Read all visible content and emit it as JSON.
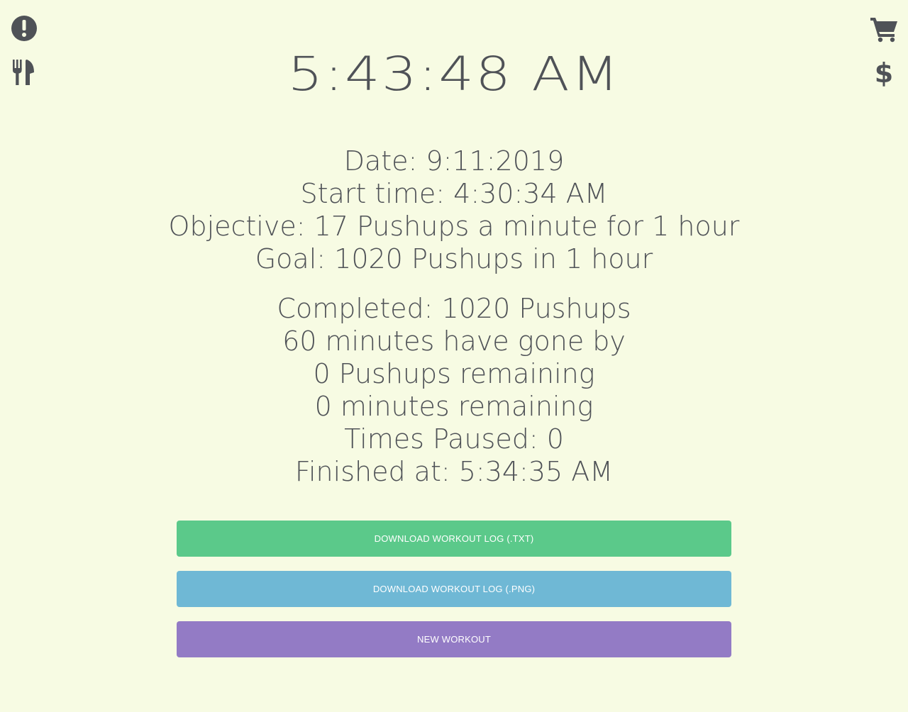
{
  "icons": {
    "top_left": [
      "alert-icon",
      "cutlery-icon"
    ],
    "top_right": [
      "cart-icon",
      "dollar-icon"
    ],
    "color": "#4f5257"
  },
  "clock": {
    "time": "5:43:48 AM"
  },
  "summary": {
    "date": "Date: 9:11:2019",
    "start_time": "Start time: 4:30:34 AM",
    "objective": "Objective: 17 Pushups a minute for 1 hour",
    "goal": "Goal: 1020 Pushups in 1 hour",
    "completed": "Completed: 1020 Pushups",
    "elapsed": "60 minutes have gone by",
    "pushups_remaining": "0 Pushups remaining",
    "minutes_remaining": "0 minutes remaining",
    "times_paused": "Times Paused: 0",
    "finished_at": "Finished at: 5:34:35 AM"
  },
  "actions": {
    "download_txt": "DOWNLOAD WORKOUT LOG (.TXT)",
    "download_png": "DOWNLOAD WORKOUT LOG (.PNG)",
    "new_workout": "NEW WORKOUT"
  },
  "colors": {
    "background": "#f7fbe3",
    "text": "#4f5257",
    "button_txt": "#5bc98a",
    "button_png": "#6fb8d5",
    "button_new": "#937bc5"
  }
}
